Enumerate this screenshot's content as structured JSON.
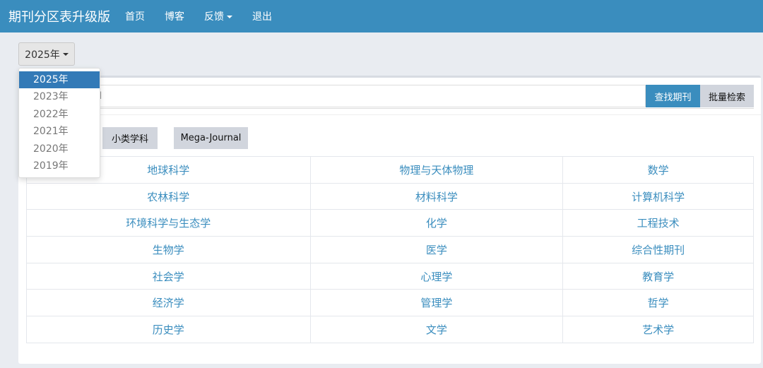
{
  "navbar": {
    "brand": "期刊分区表升级版",
    "items": [
      "首页",
      "博客",
      "反馈",
      "退出"
    ]
  },
  "year_selector": {
    "selected": "2025年",
    "options": [
      "2025年",
      "2023年",
      "2022年",
      "2021年",
      "2020年",
      "2019年"
    ]
  },
  "search": {
    "visible_text": "N",
    "find_label": "查找期刊",
    "batch_label": "批量检索"
  },
  "tabs": [
    "小类学科",
    "Mega-Journal"
  ],
  "subjects": [
    [
      "地球科学",
      "物理与天体物理",
      "数学"
    ],
    [
      "农林科学",
      "材料科学",
      "计算机科学"
    ],
    [
      "环境科学与生态学",
      "化学",
      "工程技术"
    ],
    [
      "生物学",
      "医学",
      "综合性期刊"
    ],
    [
      "社会学",
      "心理学",
      "教育学"
    ],
    [
      "经济学",
      "管理学",
      "哲学"
    ],
    [
      "历史学",
      "文学",
      "艺术学"
    ]
  ],
  "colors": {
    "primary": "#3a8dbe",
    "active": "#337ab7"
  }
}
